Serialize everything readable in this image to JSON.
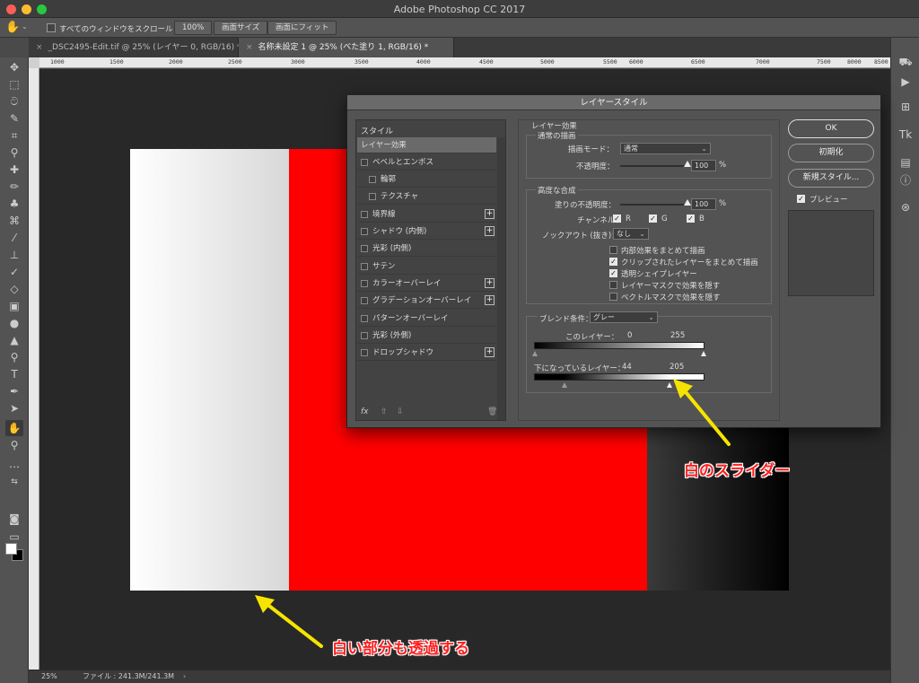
{
  "window": {
    "app_title": "Adobe Photoshop CC 2017"
  },
  "options_bar": {
    "scroll_all_label": "すべてのウィンドウをスクロール",
    "zoom_100": "100%",
    "fit_screen_size": "画面サイズ",
    "fit_screen": "画面にフィット"
  },
  "tabs": [
    {
      "label": "_DSC2495-Edit.tif @ 25% (レイヤー 0, RGB/16) *"
    },
    {
      "label": "名称未設定 1 @ 25% (べた塗り 1, RGB/16) *"
    }
  ],
  "ruler": {
    "ticks": [
      "1000",
      "1500",
      "2000",
      "2500",
      "3000",
      "3500",
      "4000",
      "4500",
      "5000",
      "5500",
      "6000",
      "6500",
      "7000",
      "7500",
      "8000",
      "8500"
    ]
  },
  "status_bar": {
    "zoom": "25%",
    "file_info": "ファイル : 241.3M/241.3M"
  },
  "dialog": {
    "title": "レイヤースタイル",
    "styles_header": "スタイル",
    "style_items": [
      {
        "label": "レイヤー効果"
      },
      {
        "label": "ベベルとエンボス"
      },
      {
        "label": "輪郭"
      },
      {
        "label": "テクスチャ"
      },
      {
        "label": "境界線"
      },
      {
        "label": "シャドウ (内側)"
      },
      {
        "label": "光彩 (内側)"
      },
      {
        "label": "サテン"
      },
      {
        "label": "カラーオーバーレイ"
      },
      {
        "label": "グラデーションオーバーレイ"
      },
      {
        "label": "パターンオーバーレイ"
      },
      {
        "label": "光彩 (外側)"
      },
      {
        "label": "ドロップシャドウ"
      }
    ],
    "fx_label": "fx",
    "blending": {
      "section_title": "レイヤー効果",
      "general_title": "通常の描画",
      "blend_mode_label": "描画モード：",
      "blend_mode_value": "通常",
      "opacity_label": "不透明度：",
      "opacity_value": "100",
      "percent": "%",
      "advanced_title": "高度な合成",
      "fill_opacity_label": "塗りの不透明度：",
      "fill_opacity_value": "100",
      "channel_label": "チャンネル：",
      "channel_r": "R",
      "channel_g": "G",
      "channel_b": "B",
      "knockout_label": "ノックアウト (抜き)：",
      "knockout_value": "なし",
      "options": [
        {
          "label": "内部効果をまとめて描画",
          "checked": false
        },
        {
          "label": "クリップされたレイヤーをまとめて描画",
          "checked": true
        },
        {
          "label": "透明シェイプレイヤー",
          "checked": true
        },
        {
          "label": "レイヤーマスクで効果を隠す",
          "checked": false
        },
        {
          "label": "ベクトルマスクで効果を隠す",
          "checked": false
        }
      ],
      "blend_if_label": "ブレンド条件：",
      "blend_if_value": "グレー",
      "this_layer_label": "このレイヤー：",
      "this_layer_low": "0",
      "this_layer_high": "255",
      "underlying_label": "下になっているレイヤー：",
      "underlying_low": "44",
      "underlying_high": "205"
    },
    "buttons": {
      "ok": "OK",
      "reset": "初期化",
      "new_style": "新規スタイル...",
      "preview": "プレビュー"
    }
  },
  "annotations": {
    "white_slider": "白のスライダー",
    "white_transparent": "白い部分も透過する"
  },
  "colors": {
    "red": "#ff0000",
    "annotation": "#ff2020",
    "arrow": "#f5e400"
  }
}
